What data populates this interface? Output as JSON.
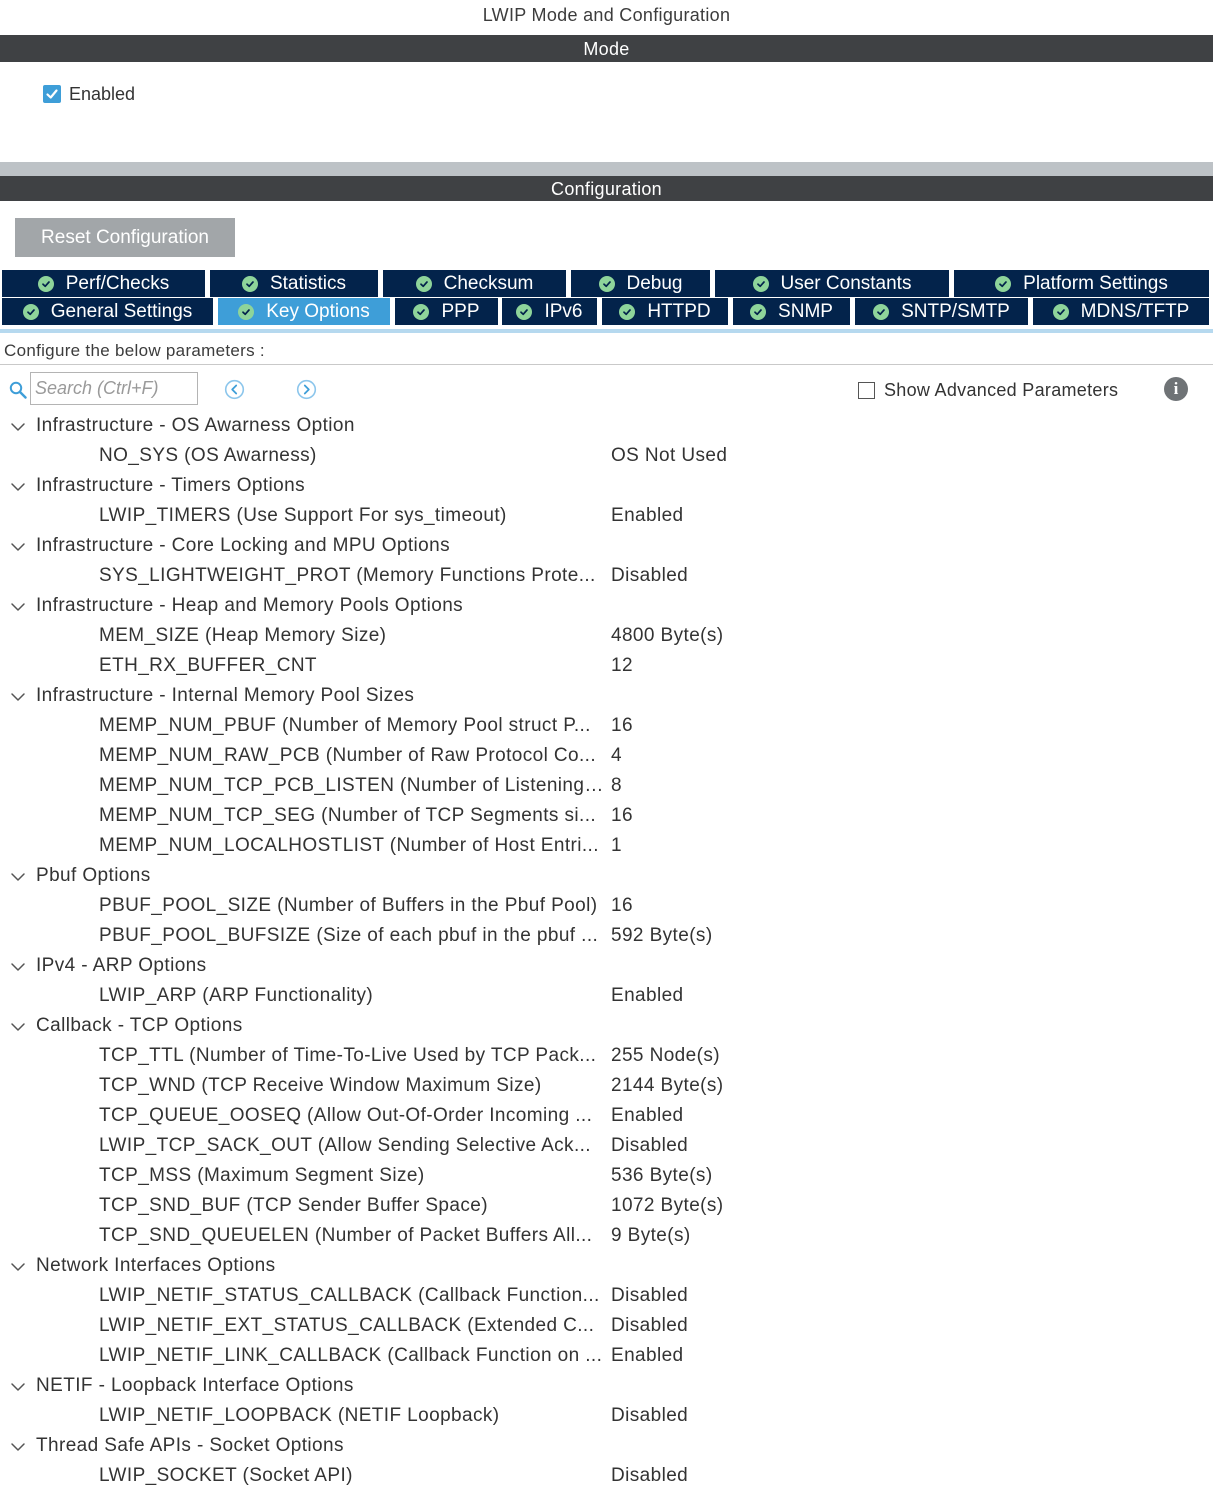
{
  "page_title": "LWIP Mode and Configuration",
  "mode": {
    "title": "Mode",
    "enabled_label": "Enabled",
    "enabled_checked": true
  },
  "configuration": {
    "title": "Configuration",
    "reset_label": "Reset Configuration"
  },
  "tabs_row1": [
    {
      "label": "Perf/Checks"
    },
    {
      "label": "Statistics"
    },
    {
      "label": "Checksum"
    },
    {
      "label": "Debug"
    },
    {
      "label": "User Constants"
    },
    {
      "label": "Platform Settings"
    }
  ],
  "tabs_row2": [
    {
      "label": "General Settings"
    },
    {
      "label": "Key Options",
      "active": true
    },
    {
      "label": "PPP"
    },
    {
      "label": "IPv6"
    },
    {
      "label": "HTTPD"
    },
    {
      "label": "SNMP"
    },
    {
      "label": "SNTP/SMTP"
    },
    {
      "label": "MDNS/TFTP"
    }
  ],
  "configure_text": "Configure the below parameters :",
  "search": {
    "placeholder": "Search (Ctrl+F)"
  },
  "show_advanced_label": "Show Advanced Parameters",
  "groups": [
    {
      "title": "Infrastructure - OS Awarness Option",
      "params": [
        {
          "name": "NO_SYS (OS Awarness)",
          "value": "OS Not Used"
        }
      ]
    },
    {
      "title": "Infrastructure - Timers Options",
      "params": [
        {
          "name": "LWIP_TIMERS (Use Support For sys_timeout)",
          "value": "Enabled"
        }
      ]
    },
    {
      "title": "Infrastructure - Core Locking and MPU Options",
      "params": [
        {
          "name": "SYS_LIGHTWEIGHT_PROT (Memory Functions Prote...",
          "value": "Disabled"
        }
      ]
    },
    {
      "title": "Infrastructure - Heap and Memory Pools Options",
      "params": [
        {
          "name": "MEM_SIZE (Heap Memory Size)",
          "value": "4800 Byte(s)"
        },
        {
          "name": "ETH_RX_BUFFER_CNT",
          "value": "12"
        }
      ]
    },
    {
      "title": "Infrastructure - Internal Memory Pool Sizes",
      "params": [
        {
          "name": "MEMP_NUM_PBUF (Number of Memory Pool struct P...",
          "value": "16"
        },
        {
          "name": "MEMP_NUM_RAW_PCB (Number of Raw Protocol Co...",
          "value": "4"
        },
        {
          "name": "MEMP_NUM_TCP_PCB_LISTEN (Number of Listening ...",
          "value": "8"
        },
        {
          "name": "MEMP_NUM_TCP_SEG (Number of TCP Segments si...",
          "value": "16"
        },
        {
          "name": "MEMP_NUM_LOCALHOSTLIST (Number of Host Entri...",
          "value": "1"
        }
      ]
    },
    {
      "title": "Pbuf Options",
      "params": [
        {
          "name": "PBUF_POOL_SIZE (Number of Buffers in the Pbuf Pool)",
          "value": "16"
        },
        {
          "name": "PBUF_POOL_BUFSIZE (Size of each pbuf in the pbuf ...",
          "value": "592 Byte(s)"
        }
      ]
    },
    {
      "title": "IPv4 - ARP Options",
      "params": [
        {
          "name": "LWIP_ARP (ARP Functionality)",
          "value": "Enabled"
        }
      ]
    },
    {
      "title": "Callback - TCP Options",
      "params": [
        {
          "name": "TCP_TTL (Number of Time-To-Live Used by TCP Pack...",
          "value": "255 Node(s)"
        },
        {
          "name": "TCP_WND (TCP Receive Window Maximum Size)",
          "value": "2144 Byte(s)"
        },
        {
          "name": "TCP_QUEUE_OOSEQ (Allow Out-Of-Order Incoming ...",
          "value": "Enabled"
        },
        {
          "name": "LWIP_TCP_SACK_OUT (Allow Sending Selective Ack...",
          "value": "Disabled"
        },
        {
          "name": "TCP_MSS (Maximum Segment Size)",
          "value": "536 Byte(s)"
        },
        {
          "name": "TCP_SND_BUF (TCP Sender Buffer Space)",
          "value": "1072 Byte(s)"
        },
        {
          "name": "TCP_SND_QUEUELEN (Number of Packet Buffers All...",
          "value": "9 Byte(s)"
        }
      ]
    },
    {
      "title": "Network Interfaces Options",
      "params": [
        {
          "name": "LWIP_NETIF_STATUS_CALLBACK (Callback Function...",
          "value": "Disabled"
        },
        {
          "name": "LWIP_NETIF_EXT_STATUS_CALLBACK (Extended C...",
          "value": "Disabled"
        },
        {
          "name": "LWIP_NETIF_LINK_CALLBACK (Callback Function on ...",
          "value": "Enabled"
        }
      ]
    },
    {
      "title": "NETIF - Loopback Interface Options",
      "params": [
        {
          "name": "LWIP_NETIF_LOOPBACK (NETIF Loopback)",
          "value": "Disabled"
        }
      ]
    },
    {
      "title": "Thread Safe APIs - Socket Options",
      "params": [
        {
          "name": "LWIP_SOCKET (Socket API)",
          "value": "Disabled"
        }
      ]
    }
  ]
}
